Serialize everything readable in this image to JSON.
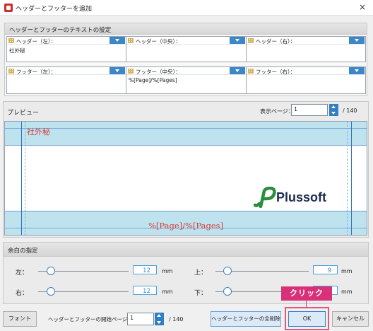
{
  "window": {
    "title": "ヘッダーとフッターを追加",
    "close": "×"
  },
  "settings": {
    "title": "ヘッダーとフッターのテキストの設定",
    "header_left": {
      "label": "ヘッダー（左）：",
      "value": "社外秘"
    },
    "header_center": {
      "label": "ヘッダー（中央）：",
      "value": ""
    },
    "header_right": {
      "label": "ヘッダー（右）：",
      "value": ""
    },
    "footer_left": {
      "label": "フッター（左）：",
      "value": ""
    },
    "footer_center": {
      "label": "フッター（中央）：",
      "value": "%[Page]/%[Pages]"
    },
    "footer_right": {
      "label": "フッター（右）：",
      "value": ""
    }
  },
  "preview": {
    "title": "プレビュー",
    "page_label": "表示ページ：",
    "page_value": "1",
    "page_total": "/ 140",
    "header_text": "社外秘",
    "footer_text": "%[Page]/%[Pages]",
    "logo_text": "Plussoft"
  },
  "margins": {
    "title": "余白の指定",
    "left": {
      "label": "左：",
      "value": "12",
      "unit": "mm"
    },
    "top": {
      "label": "上：",
      "value": "9",
      "unit": "mm"
    },
    "right": {
      "label": "右：",
      "value": "12",
      "unit": "mm"
    },
    "bottom": {
      "label": "下：",
      "value": "",
      "unit": "mm"
    }
  },
  "footer_bar": {
    "font_button": "フォント",
    "start_page_label": "ヘッダーとフッターの開始ページ：",
    "start_page_value": "1",
    "start_page_total": "/ 140",
    "delete_all_button": "ヘッダーとフッターの全削除",
    "ok_button": "OK",
    "cancel_button": "キャンセル"
  },
  "annotation": {
    "callout": "クリック"
  },
  "colors": {
    "accent": "#3b87c8",
    "preview_text": "#d73a3a",
    "callout": "#d9307a"
  }
}
